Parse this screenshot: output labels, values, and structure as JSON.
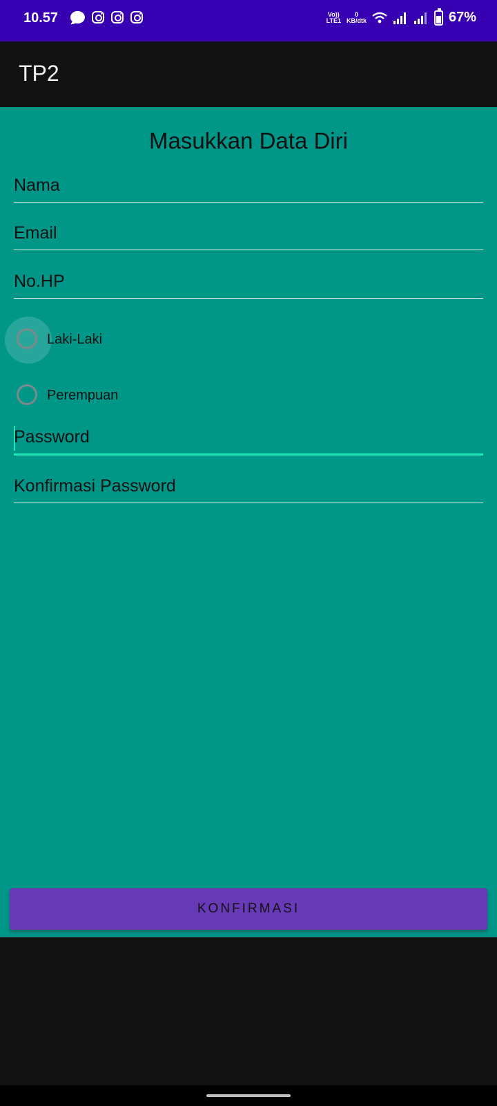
{
  "status_bar": {
    "time": "10.57",
    "network_volte": "Vo))",
    "network_lte": "LTE1",
    "data_speed_value": "0",
    "data_speed_unit": "KB/dtk",
    "battery": "67%",
    "background_color": "#3700B3",
    "battery_level": 0.67,
    "notification_icons": [
      "message-icon",
      "instagram-icon",
      "instagram-icon",
      "instagram-icon"
    ]
  },
  "app_bar": {
    "title": "TP2"
  },
  "form": {
    "title": "Masukkan Data Diri",
    "background_color": "#009688",
    "fields": {
      "nama": {
        "placeholder": "Nama"
      },
      "email": {
        "placeholder": "Email"
      },
      "no_hp": {
        "placeholder": "No.HP"
      },
      "password": {
        "placeholder": "Password",
        "focused": true
      },
      "konfirmasi_password": {
        "placeholder": "Konfirmasi Password"
      }
    },
    "gender": {
      "options": [
        "Laki-Laki",
        "Perempuan"
      ],
      "selected": null
    },
    "confirm_button": {
      "label": "KONFIRMASI",
      "color": "#673AB7"
    }
  }
}
